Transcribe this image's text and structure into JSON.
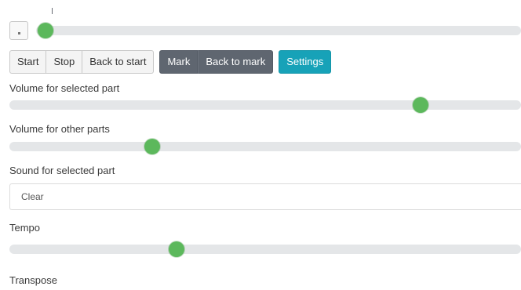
{
  "timeline": {
    "position": 0.02
  },
  "transport": {
    "start_label": "Start",
    "stop_label": "Stop",
    "back_to_start_label": "Back to start"
  },
  "marks": {
    "mark_label": "Mark",
    "back_to_mark_label": "Back to mark"
  },
  "settings": {
    "label": "Settings"
  },
  "volume_selected": {
    "label": "Volume for selected part",
    "value": 0.804
  },
  "volume_other": {
    "label": "Volume for other parts",
    "value": 0.279
  },
  "sound_selected": {
    "label": "Sound for selected part",
    "value": "Clear"
  },
  "tempo": {
    "label": "Tempo",
    "value": 0.326
  },
  "transpose": {
    "label": "Transpose"
  },
  "colors": {
    "slider_thumb": "#5cb85c",
    "slider_track": "#e4e6e8",
    "mark_buttons": "#5f6670",
    "settings_button": "#17a2b8"
  }
}
